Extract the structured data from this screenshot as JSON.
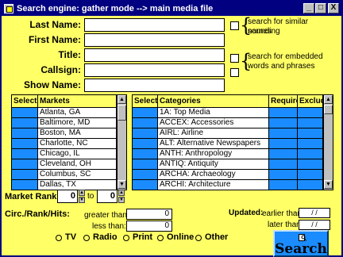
{
  "window": {
    "title": "Search engine: gather mode --> main media file",
    "buttons": {
      "minimize": "_",
      "maximize": "□",
      "close": "X"
    }
  },
  "fields": {
    "last_name": {
      "label": "Last Name:",
      "value": ""
    },
    "first_name": {
      "label": "First Name:",
      "value": ""
    },
    "title": {
      "label": "Title:",
      "value": ""
    },
    "callsign": {
      "label": "Callsign:",
      "value": ""
    },
    "show_name": {
      "label": "Show Name:",
      "value": ""
    }
  },
  "options": {
    "soundalike": {
      "checked": false,
      "brace": "{",
      "text1": "search for similar sounding",
      "text2": "names"
    },
    "embedded": {
      "checked": false,
      "brace": "{",
      "text1": "search for embedded",
      "text2": "words and phrases"
    }
  },
  "markets": {
    "columns": [
      "Select",
      "Markets"
    ],
    "rows": [
      "Atlanta, GA",
      "Baltimore, MD",
      "Boston, MA",
      "Charlotte, NC",
      "Chicago, IL",
      "Cleveland, OH",
      "Columbus, SC",
      "Dallas, TX"
    ]
  },
  "categories": {
    "columns": [
      "Select",
      "Categories",
      "Require",
      "Exclude"
    ],
    "rows": [
      "1A: Top Media",
      "ACCEX: Accessories",
      "AIRL: Airline",
      "ALT: Alternative Newspapers",
      "ANTH: Anthropology",
      "ANTIQ: Antiquity",
      "ARCHA: Archaeology",
      "ARCHI: Architecture"
    ]
  },
  "market_rank": {
    "label": "Market Rank:",
    "from": "0",
    "to_label": "to",
    "to": "0"
  },
  "circ": {
    "label": "Circ./Rank/Hits:",
    "greater_label": "greater than:",
    "greater_value": "0",
    "less_label": "less than:",
    "less_value": "0"
  },
  "updated": {
    "label": "Updated:",
    "earlier_label": "earlier than:",
    "earlier_value": "/ /",
    "later_label": "later than:",
    "later_value": "/ /"
  },
  "media_types": [
    "TV",
    "Radio",
    "Print",
    "Online",
    "Other"
  ],
  "search_button": "Search",
  "colors": {
    "window_bg": "#ffff66",
    "titlebar": "#000080",
    "select_cell": "#1a8cff"
  }
}
